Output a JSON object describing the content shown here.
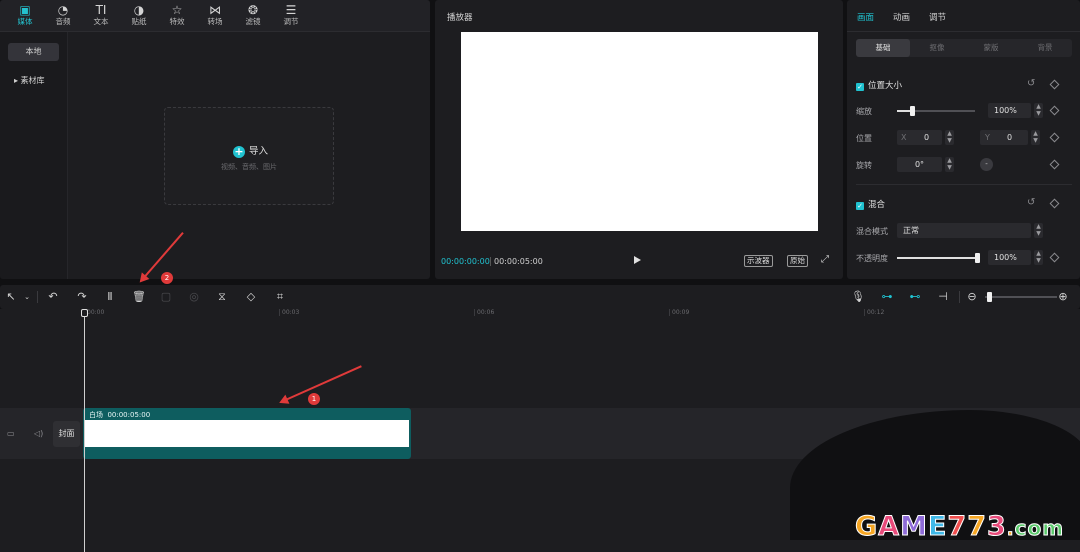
{
  "media_panel": {
    "tabs": [
      {
        "label": "媒体",
        "icon": "media-icon",
        "glyph": "▣"
      },
      {
        "label": "音频",
        "icon": "audio-icon",
        "glyph": "◔"
      },
      {
        "label": "文本",
        "icon": "text-icon",
        "glyph": "TI"
      },
      {
        "label": "贴纸",
        "icon": "sticker-icon",
        "glyph": "◑"
      },
      {
        "label": "特效",
        "icon": "effects-icon",
        "glyph": "☆"
      },
      {
        "label": "转场",
        "icon": "transition-icon",
        "glyph": "⋈"
      },
      {
        "label": "滤镜",
        "icon": "filter-icon",
        "glyph": "❂"
      },
      {
        "label": "调节",
        "icon": "adjust-icon",
        "glyph": "☰"
      }
    ],
    "side": {
      "local": "本地",
      "library": "▸ 素材库"
    },
    "import": {
      "label": "导入",
      "sub": "视频、音频、图片"
    }
  },
  "player": {
    "title": "播放器",
    "current_time": "00:00:00:00",
    "total_time": "00:00:05:00",
    "btn_scope": "示波器",
    "btn_original": "原始"
  },
  "inspector": {
    "tabs": [
      "画面",
      "动画",
      "调节"
    ],
    "subtabs": [
      "基础",
      "抠像",
      "蒙版",
      "背景"
    ],
    "position_size": {
      "title": "位置大小",
      "scale_label": "缩放",
      "scale_value": "100%",
      "scale_level": 0.2,
      "position_label": "位置",
      "x_label": "X",
      "x_value": "0",
      "y_label": "Y",
      "y_value": "0",
      "rotation_label": "旋转",
      "rotation_value": "0°"
    },
    "blend": {
      "title": "混合",
      "mode_label": "混合模式",
      "mode_value": "正常",
      "opacity_label": "不透明度",
      "opacity_value": "100%",
      "opacity_level": 1.0
    }
  },
  "toolbar": {
    "items": [
      "pointer-tool",
      "undo",
      "redo",
      "split",
      "delete",
      "freeze",
      "reverse",
      "mirror",
      "rotate",
      "crop"
    ],
    "right_items": [
      "microphone",
      "link-main-track",
      "preview-axis",
      "auto-snap",
      "zoom-out",
      "zoom-in"
    ]
  },
  "timeline": {
    "ticks": [
      "00:00",
      "00:03",
      "00:06",
      "00:09",
      "00:12"
    ],
    "cover_label": "封面",
    "clip_label": "白场",
    "clip_duration": "00:00:05:00"
  },
  "annotations": {
    "badge1": "1",
    "badge2": "2"
  },
  "watermark": {
    "text": "GAME773.com"
  },
  "colors": {
    "accent": "#20c2d0",
    "clip": "#0e5d5f",
    "annotation": "#e03a3a"
  }
}
